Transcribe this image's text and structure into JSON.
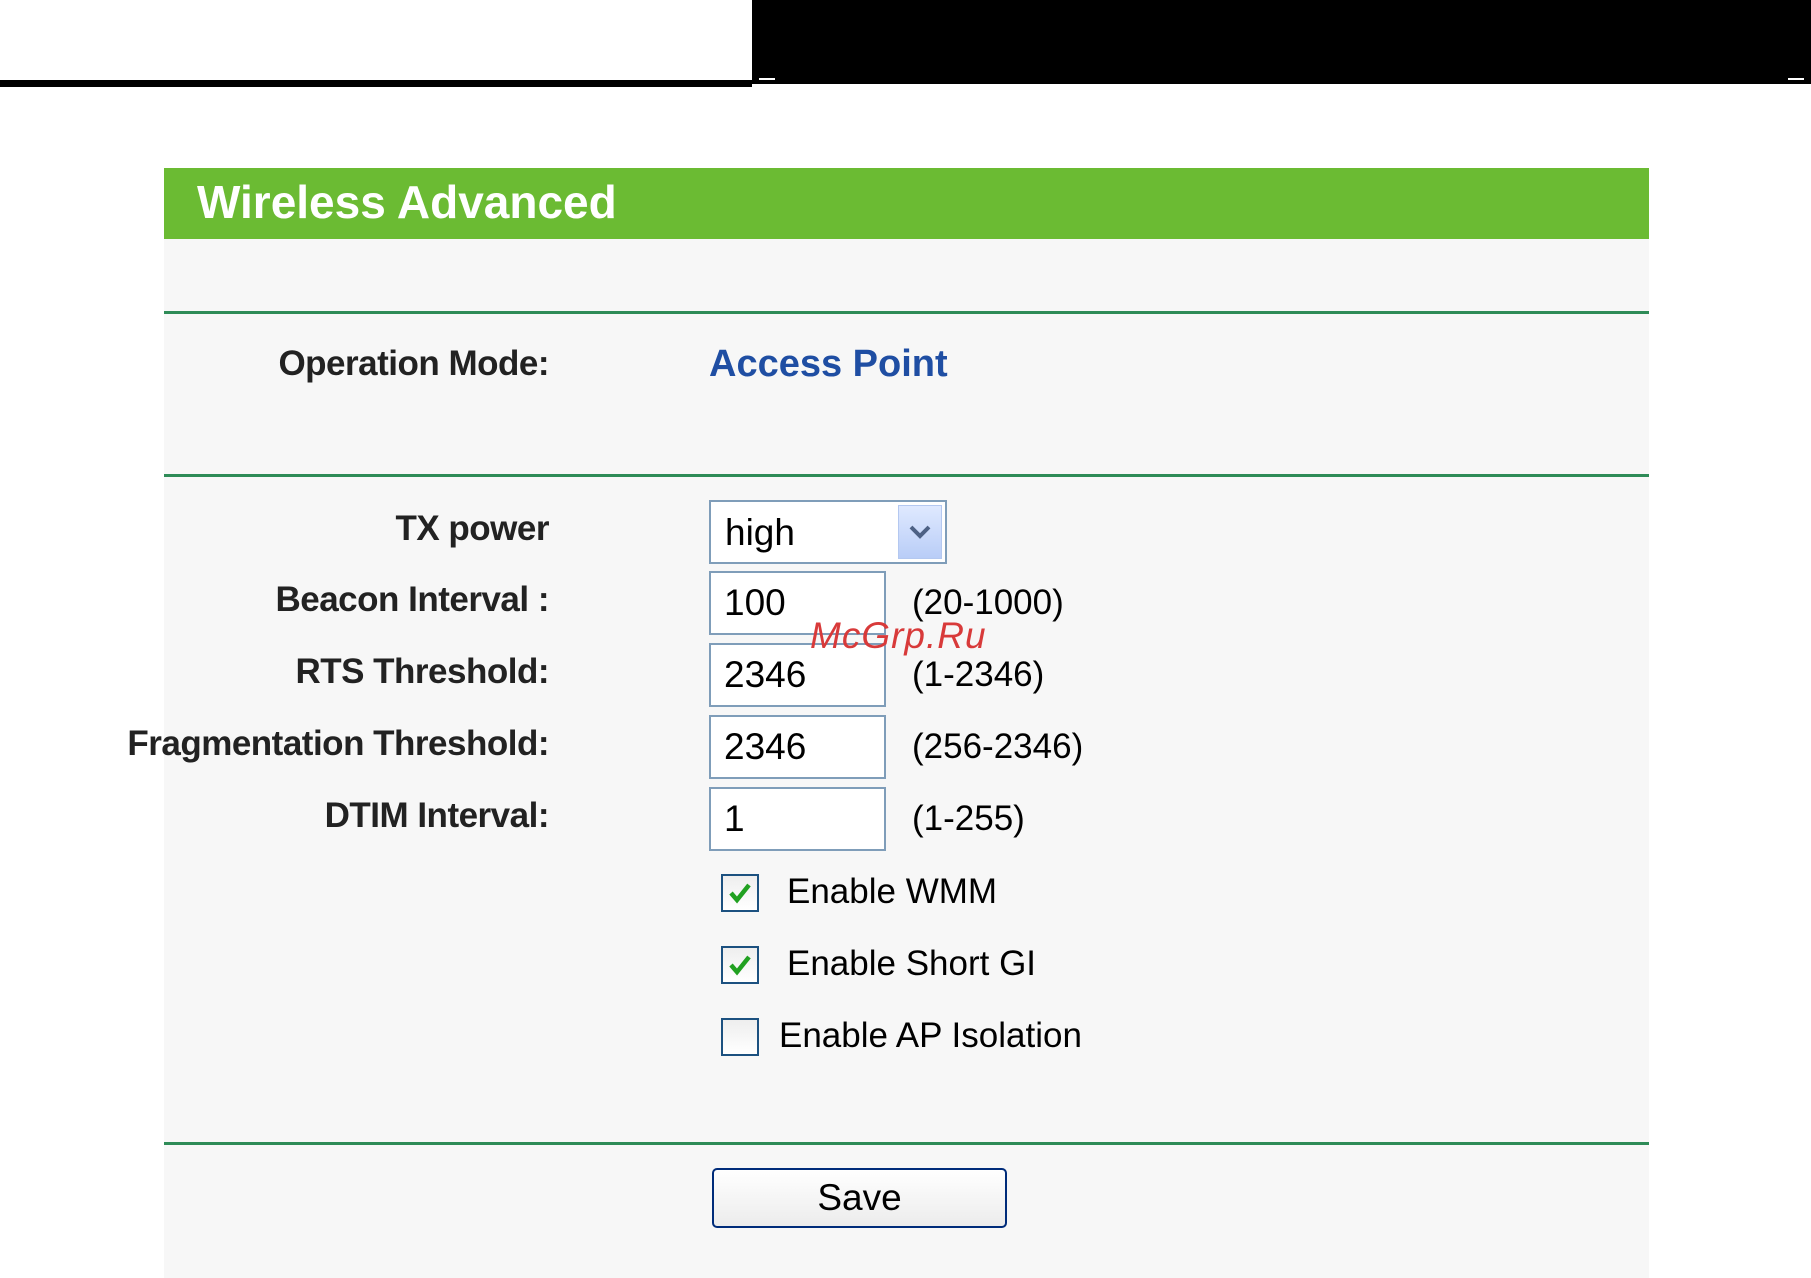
{
  "page": {
    "title": "Wireless Advanced",
    "operation_mode": {
      "label": "Operation Mode:",
      "value": "Access Point"
    },
    "tx_power": {
      "label": "TX power",
      "value": "high"
    },
    "beacon_interval": {
      "label": "Beacon Interval :",
      "value": "100",
      "range": "(20-1000)"
    },
    "rts_threshold": {
      "label": "RTS Threshold:",
      "value": "2346",
      "range": "(1-2346)"
    },
    "fragmentation_threshold": {
      "label": "Fragmentation Threshold:",
      "value": "2346",
      "range": "(256-2346)"
    },
    "dtim_interval": {
      "label": "DTIM Interval:",
      "value": "1",
      "range": "(1-255)"
    },
    "checkboxes": [
      {
        "label": "Enable WMM",
        "checked": true
      },
      {
        "label": "Enable Short GI",
        "checked": true
      },
      {
        "label": "Enable AP Isolation",
        "checked": false
      }
    ],
    "save_label": "Save",
    "watermark": "McGrp.Ru"
  },
  "colors": {
    "banner": "#6bbb33",
    "divider": "#2e8b57",
    "value_blue": "#1f4ea3",
    "check_green": "#21a121"
  }
}
